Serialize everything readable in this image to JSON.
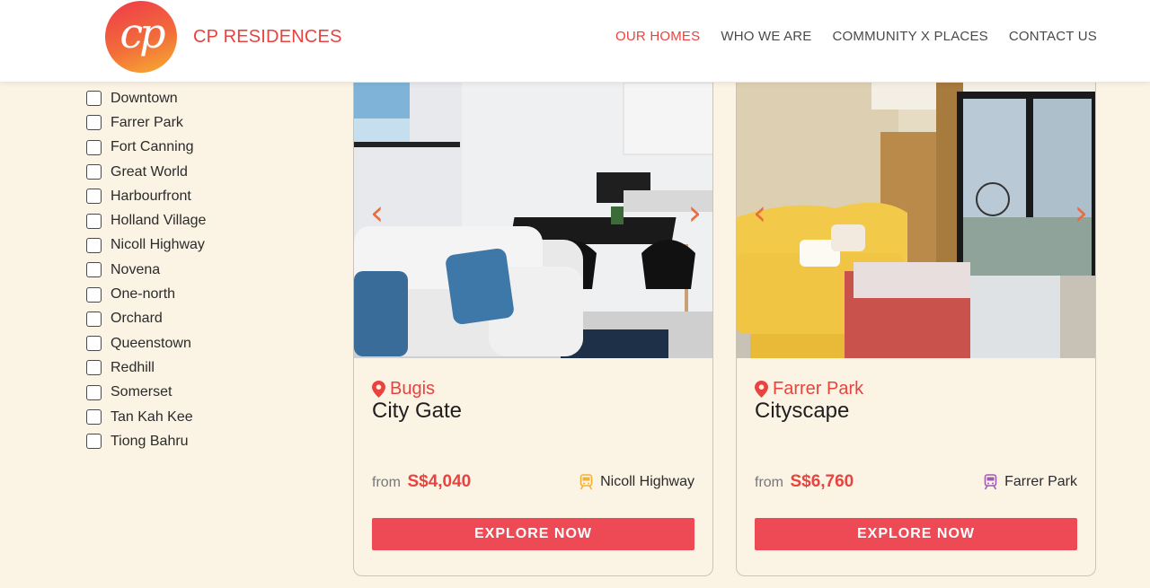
{
  "header": {
    "brand": "CP RESIDENCES",
    "logo_text": "cp",
    "nav": [
      "OUR HOMES",
      "WHO WE ARE",
      "COMMUNITY X PLACES",
      "CONTACT US"
    ]
  },
  "filters": [
    "Downtown",
    "Farrer Park",
    "Fort Canning",
    "Great World",
    "Harbourfront",
    "Holland Village",
    "Nicoll Highway",
    "Novena",
    "One-north",
    "Orchard",
    "Queenstown",
    "Redhill",
    "Somerset",
    "Tan Kah Kee",
    "Tiong Bahru"
  ],
  "cards": [
    {
      "location": "Bugis",
      "title": "City Gate",
      "price_prefix": "from",
      "price": "S$4,040",
      "station": "Nicoll Highway",
      "button": "EXPLORE NOW",
      "train_color": "#f2b233"
    },
    {
      "location": "Farrer Park",
      "title": "Cityscape",
      "price_prefix": "from",
      "price": "S$6,760",
      "station": "Farrer Park",
      "button": "EXPLORE NOW",
      "train_color": "#a05bb0"
    }
  ],
  "colors": {
    "accent": "#e8433f",
    "button": "#ee4a55",
    "background": "#fbf3e4"
  }
}
